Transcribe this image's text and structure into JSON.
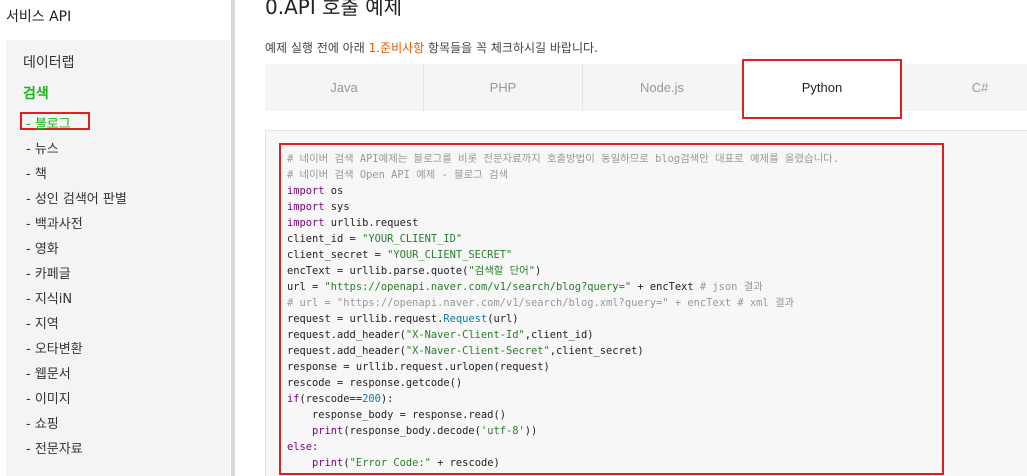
{
  "sidebar": {
    "title": "서비스 API",
    "heading": "데이터랩",
    "category": "검색",
    "items": [
      {
        "label": "- 블로그",
        "active": true
      },
      {
        "label": "- 뉴스"
      },
      {
        "label": "- 책"
      },
      {
        "label": "- 성인 검색어 판별"
      },
      {
        "label": "- 백과사전"
      },
      {
        "label": "- 영화"
      },
      {
        "label": "- 카페글"
      },
      {
        "label": "- 지식iN"
      },
      {
        "label": "- 지역"
      },
      {
        "label": "- 오타변환"
      },
      {
        "label": "- 웹문서"
      },
      {
        "label": "- 이미지"
      },
      {
        "label": "- 쇼핑"
      },
      {
        "label": "- 전문자료"
      }
    ]
  },
  "main": {
    "title": "0.API 호출 예제",
    "desc_prefix": "예제 실행 전에 아래 ",
    "desc_link": "1.준비사항",
    "desc_suffix": " 항목들을 꼭 체크하시길 바랍니다.",
    "tabs": [
      {
        "label": "Java"
      },
      {
        "label": "PHP"
      },
      {
        "label": "Node.js"
      },
      {
        "label": "Python",
        "active": true
      },
      {
        "label": "C#"
      }
    ],
    "code_lines": [
      "# 네이버 검색 API예제는 블로그를 비롯 전문자료까지 호출방법이 동일하므로 blog검색만 대표로 예제를 올렸습니다.",
      "# 네이버 검색 Open API 예제 - 블로그 검색",
      "import os",
      "import sys",
      "import urllib.request",
      "client_id = \"YOUR_CLIENT_ID\"",
      "client_secret = \"YOUR_CLIENT_SECRET\"",
      "encText = urllib.parse.quote(\"검색할 단어\")",
      "url = \"https://openapi.naver.com/v1/search/blog?query=\" + encText # json 결과",
      "# url = \"https://openapi.naver.com/v1/search/blog.xml?query=\" + encText # xml 결과",
      "request = urllib.request.Request(url)",
      "request.add_header(\"X-Naver-Client-Id\",client_id)",
      "request.add_header(\"X-Naver-Client-Secret\",client_secret)",
      "response = urllib.request.urlopen(request)",
      "rescode = response.getcode()",
      "if(rescode==200):",
      "    response_body = response.read()",
      "    print(response_body.decode('utf-8'))",
      "else:",
      "    print(\"Error Code:\" + rescode)"
    ]
  }
}
